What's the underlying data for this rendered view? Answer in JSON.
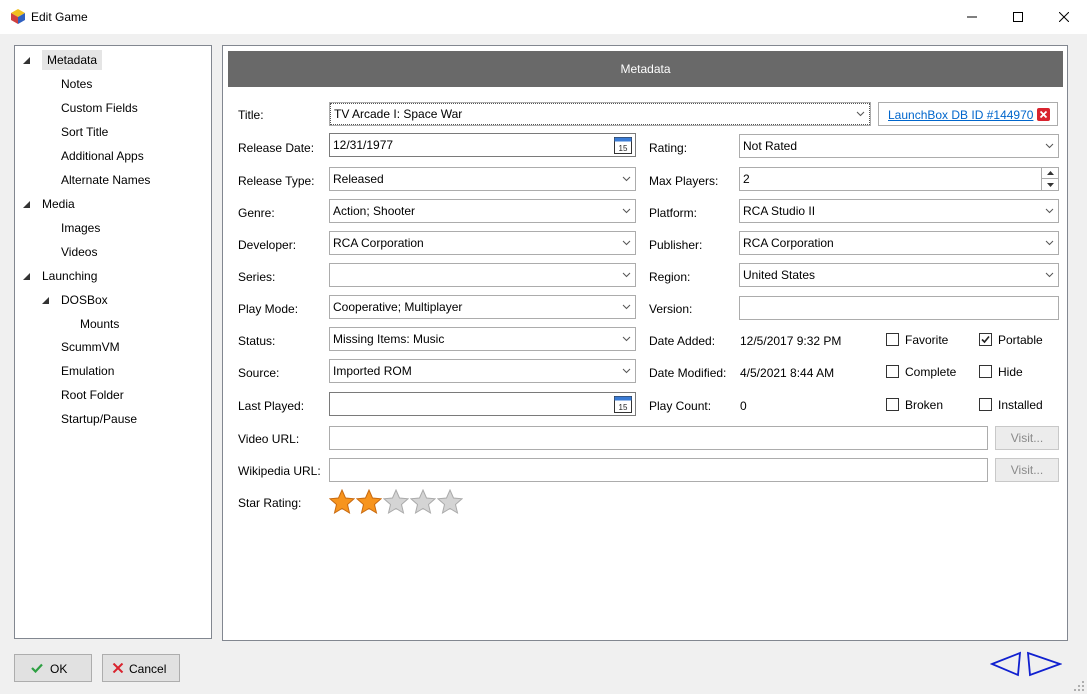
{
  "window": {
    "title": "Edit Game"
  },
  "tree": {
    "items": [
      {
        "label": "Metadata",
        "level": 0,
        "expanded": true,
        "selected": true
      },
      {
        "label": "Notes",
        "level": 1
      },
      {
        "label": "Custom Fields",
        "level": 1
      },
      {
        "label": "Sort Title",
        "level": 1
      },
      {
        "label": "Additional Apps",
        "level": 1
      },
      {
        "label": "Alternate Names",
        "level": 1
      },
      {
        "label": "Media",
        "level": 0,
        "expanded": true
      },
      {
        "label": "Images",
        "level": 1
      },
      {
        "label": "Videos",
        "level": 1
      },
      {
        "label": "Launching",
        "level": 0,
        "expanded": true
      },
      {
        "label": "DOSBox",
        "level": 1,
        "expanded": true
      },
      {
        "label": "Mounts",
        "level": 2
      },
      {
        "label": "ScummVM",
        "level": 1
      },
      {
        "label": "Emulation",
        "level": 1
      },
      {
        "label": "Root Folder",
        "level": 1
      },
      {
        "label": "Startup/Pause",
        "level": 1
      }
    ]
  },
  "panel": {
    "header": "Metadata"
  },
  "fields": {
    "title": {
      "label": "Title:",
      "value": "TV Arcade I: Space War"
    },
    "launchbox_link": "LaunchBox DB ID #144970",
    "release_date": {
      "label": "Release Date:",
      "value": "12/31/1977"
    },
    "release_type": {
      "label": "Release Type:",
      "value": "Released"
    },
    "genre": {
      "label": "Genre:",
      "value": "Action; Shooter"
    },
    "developer": {
      "label": "Developer:",
      "value": "RCA Corporation"
    },
    "series": {
      "label": "Series:",
      "value": ""
    },
    "play_mode": {
      "label": "Play Mode:",
      "value": "Cooperative; Multiplayer"
    },
    "status": {
      "label": "Status:",
      "value": "Missing Items: Music"
    },
    "source": {
      "label": "Source:",
      "value": "Imported ROM"
    },
    "last_played": {
      "label": "Last Played:",
      "value": ""
    },
    "rating": {
      "label": "Rating:",
      "value": "Not Rated"
    },
    "max_players": {
      "label": "Max Players:",
      "value": "2"
    },
    "platform": {
      "label": "Platform:",
      "value": "RCA Studio II"
    },
    "publisher": {
      "label": "Publisher:",
      "value": "RCA Corporation"
    },
    "region": {
      "label": "Region:",
      "value": "United States"
    },
    "version": {
      "label": "Version:",
      "value": ""
    },
    "date_added": {
      "label": "Date Added:",
      "value": "12/5/2017 9:32 PM"
    },
    "date_modified": {
      "label": "Date Modified:",
      "value": "4/5/2021 8:44 AM"
    },
    "play_count": {
      "label": "Play Count:",
      "value": "0"
    },
    "video_url": {
      "label": "Video URL:",
      "value": ""
    },
    "wikipedia_url": {
      "label": "Wikipedia URL:",
      "value": ""
    },
    "star_rating": {
      "label": "Star Rating:",
      "value": 2,
      "max": 5
    }
  },
  "checkboxes": {
    "favorite": {
      "label": "Favorite",
      "checked": false
    },
    "portable": {
      "label": "Portable",
      "checked": true
    },
    "complete": {
      "label": "Complete",
      "checked": false
    },
    "hide": {
      "label": "Hide",
      "checked": false
    },
    "broken": {
      "label": "Broken",
      "checked": false
    },
    "installed": {
      "label": "Installed",
      "checked": false
    }
  },
  "buttons": {
    "visit": "Visit...",
    "ok": "OK",
    "cancel": "Cancel"
  },
  "colors": {
    "header_bg": "#696969",
    "link": "#0066cc",
    "star_filled": "#f7941d",
    "star_empty": "#d0d0d0",
    "ok_check": "#2ea043",
    "cancel_x": "#d9232e",
    "nav_arrows": "#0000cc"
  }
}
